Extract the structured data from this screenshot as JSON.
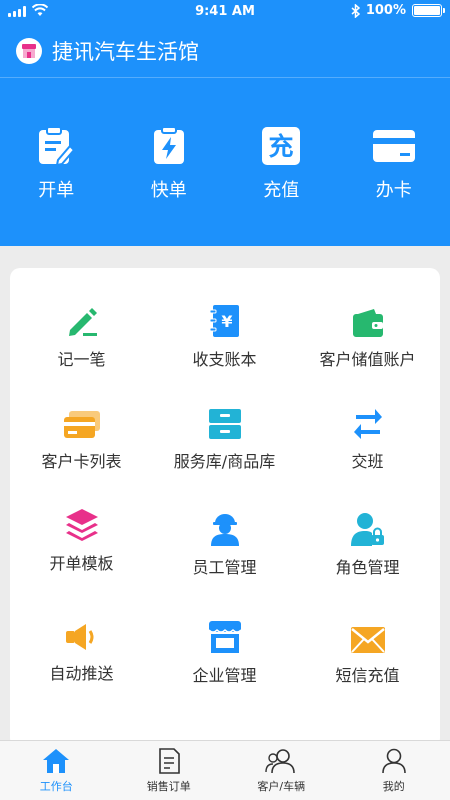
{
  "status_bar": {
    "time": "9:41 AM",
    "battery": "100%"
  },
  "app": {
    "title": "捷讯汽车生活馆"
  },
  "quick_actions": [
    {
      "label": "开单",
      "icon": "clipboard-edit-icon"
    },
    {
      "label": "快单",
      "icon": "lightning-icon"
    },
    {
      "label": "充值",
      "icon": "recharge-icon",
      "icon_text": "充"
    },
    {
      "label": "办卡",
      "icon": "card-icon"
    }
  ],
  "features": [
    {
      "label": "记一笔",
      "icon": "pen-icon",
      "color": "#27b86f"
    },
    {
      "label": "收支账本",
      "icon": "ledger-icon",
      "color": "#1d91fb",
      "icon_text": "¥"
    },
    {
      "label": "客户储值账户",
      "icon": "wallet-icon",
      "color": "#27b86f"
    },
    {
      "label": "客户卡列表",
      "icon": "cards-icon",
      "color": "#f5a623"
    },
    {
      "label": "服务库/商品库",
      "icon": "cabinet-icon",
      "color": "#22b3d6"
    },
    {
      "label": "交班",
      "icon": "swap-icon",
      "color": "#1d91fb"
    },
    {
      "label": "开单模板",
      "icon": "layers-icon",
      "color": "#e8308a"
    },
    {
      "label": "员工管理",
      "icon": "worker-icon",
      "color": "#1d91fb"
    },
    {
      "label": "角色管理",
      "icon": "user-lock-icon",
      "color": "#22b3d6"
    },
    {
      "label": "自动推送",
      "icon": "speaker-icon",
      "color": "#f5a623"
    },
    {
      "label": "企业管理",
      "icon": "store-icon",
      "color": "#1d91fb"
    },
    {
      "label": "短信充值",
      "icon": "mail-icon",
      "color": "#f5a623"
    }
  ],
  "tabs": [
    {
      "label": "工作台",
      "icon": "home-icon",
      "active": true
    },
    {
      "label": "销售订单",
      "icon": "document-icon",
      "active": false
    },
    {
      "label": "客户/车辆",
      "icon": "customers-icon",
      "active": false
    },
    {
      "label": "我的",
      "icon": "profile-icon",
      "active": false
    }
  ],
  "colors": {
    "primary": "#1d91fb",
    "background": "#ececec",
    "card": "#ffffff"
  }
}
